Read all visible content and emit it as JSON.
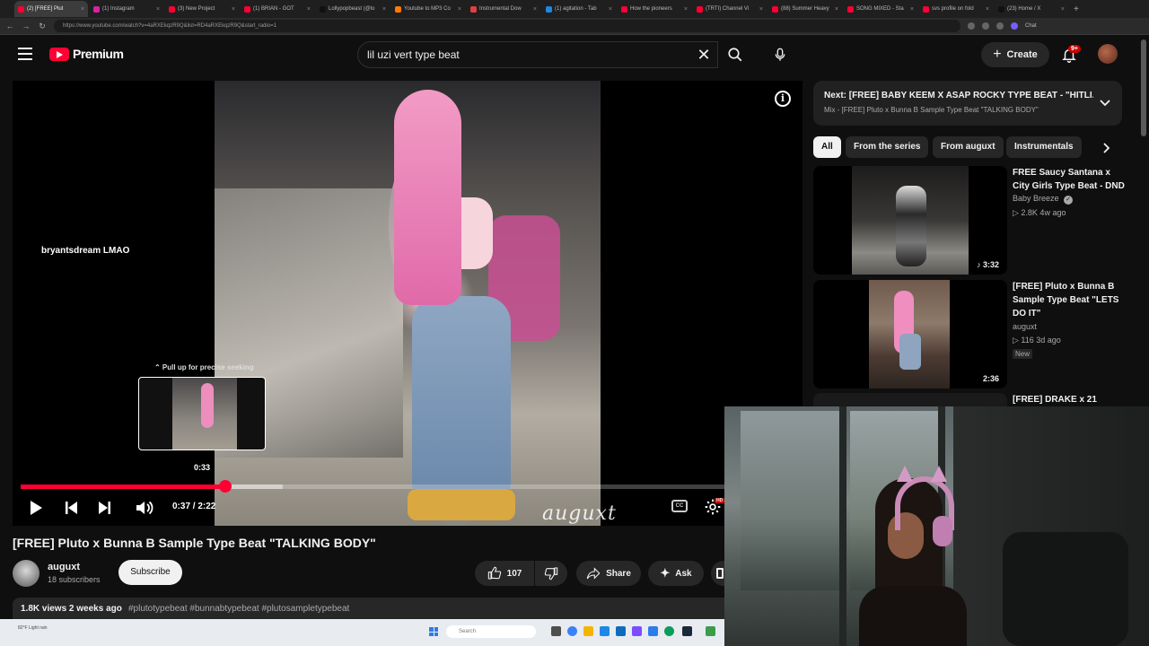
{
  "browser": {
    "tabs": [
      {
        "label": "(2) [FREE] Plut",
        "active": true,
        "color": "#ff0033"
      },
      {
        "label": "(1) Instagram",
        "active": false,
        "color": "#d6249f"
      },
      {
        "label": "(3) New Project",
        "active": false,
        "color": "#ff0033"
      },
      {
        "label": "(1) BRIAN - GOT",
        "active": false,
        "color": "#ff0033"
      },
      {
        "label": "Lollypopbeast (@lo",
        "active": false,
        "color": "#111111"
      },
      {
        "label": "Youtube to MP3 Co",
        "active": false,
        "color": "#ff7a00"
      },
      {
        "label": "Instrumental Dow",
        "active": false,
        "color": "#e04040"
      },
      {
        "label": "(1) agitation - Tab",
        "active": false,
        "color": "#1e88e5"
      },
      {
        "label": "How the pioneers",
        "active": false,
        "color": "#ff0033"
      },
      {
        "label": "(TRTI) Channel Vi",
        "active": false,
        "color": "#ff0033"
      },
      {
        "label": "(88) Summer Heavy",
        "active": false,
        "color": "#ff0033"
      },
      {
        "label": "SONG MIXED - Sta",
        "active": false,
        "color": "#ff0033"
      },
      {
        "label": "svs profile on fold",
        "active": false,
        "color": "#ff0033"
      },
      {
        "label": "(23) Home / X",
        "active": false,
        "color": "#111111"
      }
    ],
    "url": "https://www.youtube.com/watch?v=4aRXEkqzR9Q&list=RD4aRXEkqzR9Q&start_radio=1",
    "profile_label": "Chat"
  },
  "header": {
    "logo_text": "Premium",
    "search_value": "lil uzi vert type beat",
    "create_label": "Create",
    "notification_badge": "9+"
  },
  "player": {
    "overlay_text": "bryantsdream  LMAO",
    "watermark": "auguxt",
    "pullup_hint": "⌃ Pull up for precise seeking",
    "seek_time": "0:33",
    "time_display": "0:37 / 2:22",
    "progress_played": 0.265,
    "progress_buffered": 0.34,
    "hd_badge": "HD"
  },
  "video": {
    "title": "[FREE] Pluto x Bunna B Sample Type Beat \"TALKING BODY\"",
    "channel_name": "auguxt",
    "subscriber_count": "18 subscribers",
    "subscribe_label": "Subscribe",
    "like_count": "107",
    "share_label": "Share",
    "ask_label": "Ask",
    "views_date": "1.8K views  2 weeks ago",
    "hashtags": "#plutotypebeat #bunnabtypebeat #plutosampletypebeat"
  },
  "sidebar": {
    "next_title": "Next: [FREE] BABY KEEM X ASAP ROCKY TYPE BEAT - \"HITLI...",
    "next_subtitle": "Mix - [FREE] Pluto x Bunna B Sample Type Beat \"TALKING BODY\"",
    "chips": [
      "All",
      "From the series",
      "From auguxt",
      "Instrumentals"
    ],
    "recommendations": [
      {
        "title": "FREE Saucy Santana x City Girls Type Beat - DND",
        "channel": "Baby Breeze",
        "stats": "▷ 2.8K  4w ago",
        "duration": "♪ 3:32",
        "new": ""
      },
      {
        "title": "[FREE] Pluto x Bunna B Sample Type Beat \"LETS DO IT\"",
        "channel": "auguxt",
        "stats": "▷ 116  3d ago",
        "duration": "2:36",
        "new": "New"
      }
    ],
    "rec3_title": "[FREE] DRAKE x 21"
  },
  "taskbar": {
    "search_placeholder": "Search",
    "weather": "82°F Light rain"
  },
  "colors": {
    "accent": "#ff0033",
    "background": "#0f0f0f",
    "chip_bg": "#272727"
  }
}
